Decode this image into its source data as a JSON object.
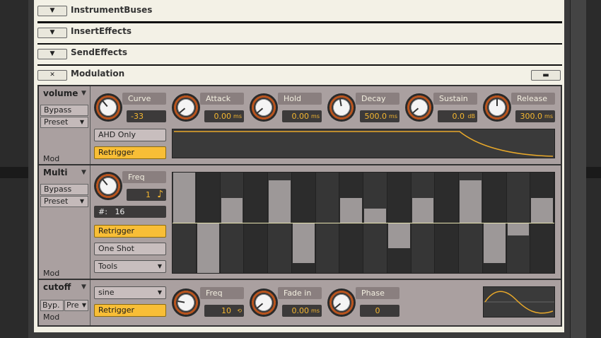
{
  "panels": [
    {
      "label": "InstrumentBuses",
      "button": "▼"
    },
    {
      "label": "InsertEffects",
      "button": "▼"
    },
    {
      "label": "SendEffects",
      "button": "▼"
    },
    {
      "label": "Modulation",
      "button": "✕"
    }
  ],
  "volume": {
    "title": "volume",
    "bypass": "Bypass",
    "preset": "Preset",
    "mod": "Mod",
    "ahd_only": "AHD Only",
    "retrigger": "Retrigger",
    "curve": {
      "label": "Curve",
      "value": "-33"
    },
    "attack": {
      "label": "Attack",
      "value": "0.00",
      "unit": "ms"
    },
    "hold": {
      "label": "Hold",
      "value": "0.00",
      "unit": "ms"
    },
    "decay": {
      "label": "Decay",
      "value": "500.0",
      "unit": "ms"
    },
    "sustain": {
      "label": "Sustain",
      "value": "0.0",
      "unit": "dB"
    },
    "release": {
      "label": "Release",
      "value": "300.0",
      "unit": "ms"
    }
  },
  "multi": {
    "title": "Multi",
    "bypass": "Bypass",
    "preset": "Preset",
    "mod": "Mod",
    "freq": {
      "label": "Freq",
      "value": "1",
      "note_icon": "♪"
    },
    "steps_label": "#:",
    "steps_value": "16",
    "retrigger": "Retrigger",
    "one_shot": "One Shot",
    "tools": "Tools",
    "steps": [
      1.0,
      -1.0,
      0.5,
      0.0,
      0.85,
      -0.8,
      0.0,
      0.5,
      0.28,
      -0.5,
      0.5,
      0.0,
      0.85,
      -0.8,
      -0.25,
      0.5
    ]
  },
  "cutoff": {
    "title": "cutoff",
    "bypass": "Byp.",
    "preset": "Pre",
    "mod": "Mod",
    "waveform": "sine",
    "retrigger": "Retrigger",
    "freq": {
      "label": "Freq",
      "value": "10"
    },
    "fade_in": {
      "label": "Fade in",
      "value": "0.00",
      "unit": "ms"
    },
    "phase": {
      "label": "Phase",
      "value": "0"
    }
  },
  "colors": {
    "accent": "#f8be36",
    "knob_ring": "#b8541e",
    "display_bg": "#3a3a3a",
    "curve": "#e8a82a"
  }
}
